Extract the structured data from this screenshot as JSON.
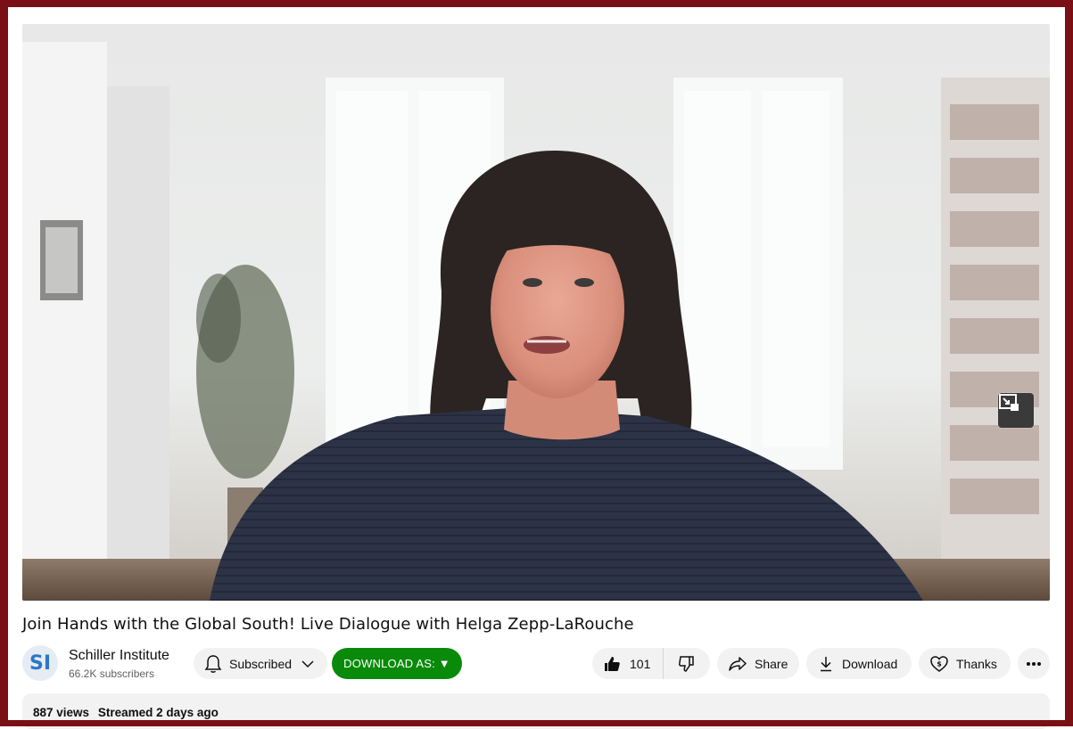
{
  "video": {
    "title": "Join Hands with the Global South! Live Dialogue with Helga Zepp-LaRouche",
    "miniplayer_icon": "miniplayer-icon"
  },
  "channel": {
    "avatar_text": "SI",
    "name": "Schiller Institute",
    "subscribers": "66.2K subscribers"
  },
  "actions": {
    "subscribed_label": "Subscribed",
    "download_as_label": "DOWNLOAD AS: ▼",
    "like_count": "101",
    "share_label": "Share",
    "download_label": "Download",
    "thanks_label": "Thanks"
  },
  "description": {
    "views": "887 views",
    "streamed": "Streamed 2 days ago"
  },
  "colors": {
    "frame": "#7b0f16",
    "download_as_bg": "#0a8a0a",
    "pill_bg": "#f2f2f2"
  }
}
